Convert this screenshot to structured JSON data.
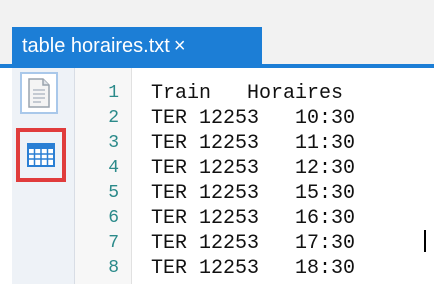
{
  "tab": {
    "title": "table horaires.txt",
    "close_glyph": "×"
  },
  "sidebar": {
    "items": [
      {
        "name": "document-icon",
        "selected": false
      },
      {
        "name": "table-grid-icon",
        "highlighted": true,
        "highlight_color": "#e03c3c"
      }
    ]
  },
  "editor": {
    "lines": [
      {
        "number": "1",
        "text": "Train   Horaires"
      },
      {
        "number": "2",
        "text": "TER 12253   10:30"
      },
      {
        "number": "3",
        "text": "TER 12253   11:30"
      },
      {
        "number": "4",
        "text": "TER 12253   12:30"
      },
      {
        "number": "5",
        "text": "TER 12253   15:30"
      },
      {
        "number": "6",
        "text": "TER 12253   16:30"
      },
      {
        "number": "7",
        "text": "TER 12253   17:30"
      },
      {
        "number": "8",
        "text": "TER 12253   18:30"
      }
    ]
  },
  "colors": {
    "accent": "#1c7ed6",
    "line_number": "#2b8a8a"
  }
}
